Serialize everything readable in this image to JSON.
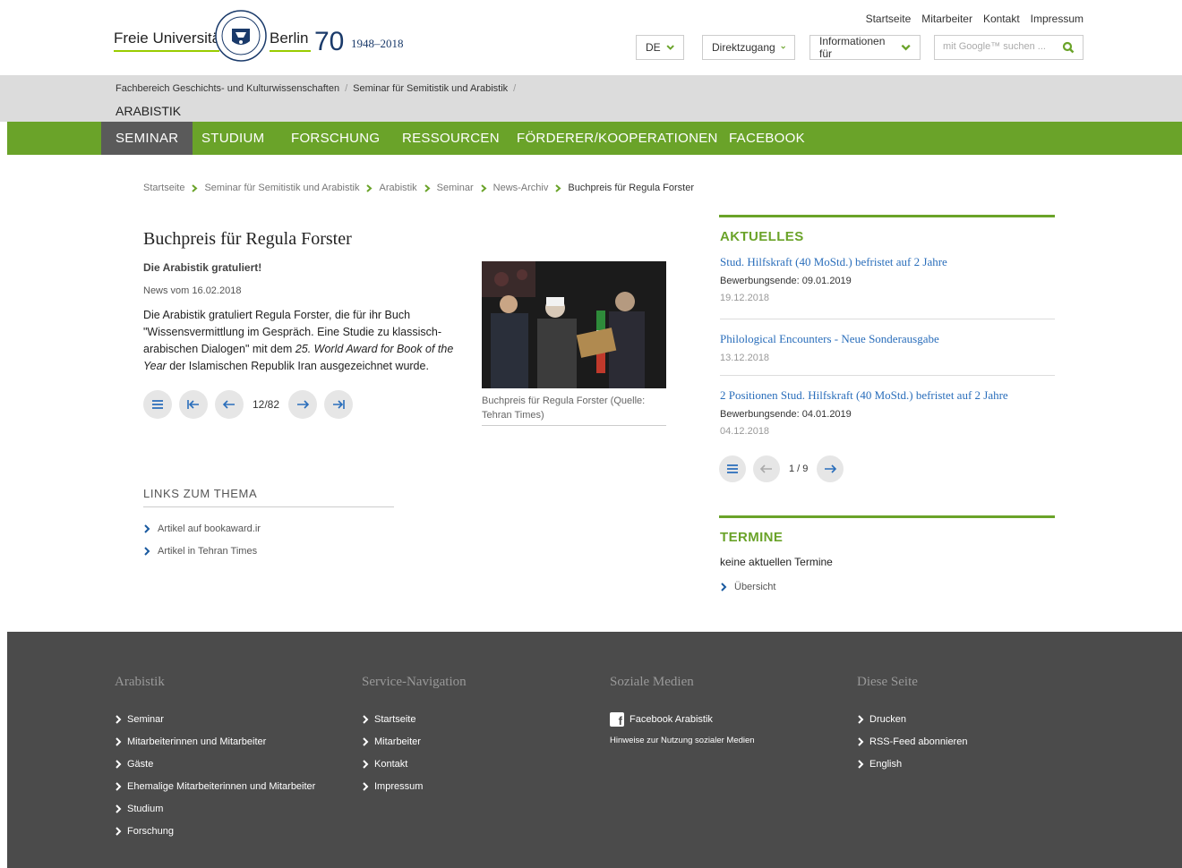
{
  "header": {
    "logo_left": "Freie Universität",
    "logo_right": "Berlin",
    "anniversary_number": "70",
    "anniversary_years": "1948–2018",
    "service_links": [
      "Startseite",
      "Mitarbeiter",
      "Kontakt",
      "Impressum"
    ],
    "language_label": "DE",
    "direct_access_label": "Direktzugang",
    "info_for_label": "Informationen für",
    "search_placeholder": "mit Google™ suchen ..."
  },
  "greybar": {
    "crumbs": [
      "Fachbereich Geschichts- und Kulturwissenschaften",
      "Seminar für Semitistik und Arabistik"
    ],
    "section": "ARABISTIK"
  },
  "nav": {
    "items": [
      "SEMINAR",
      "STUDIUM",
      "FORSCHUNG",
      "RESSOURCEN",
      "FÖRDERER/KOOPERATIONEN",
      "FACEBOOK"
    ]
  },
  "breadcrumb": {
    "items": [
      "Startseite",
      "Seminar für Semitistik und Arabistik",
      "Arabistik",
      "Seminar",
      "News-Archiv"
    ],
    "current": "Buchpreis für Regula Forster"
  },
  "article": {
    "title": "Buchpreis für Regula Forster",
    "subtitle": "Die Arabistik gratuliert!",
    "date": "News vom 16.02.2018",
    "body_1": "Die Arabistik gratuliert Regula Forster, die für ihr Buch \"Wissensvermittlung im Gespräch. Eine Studie zu klassisch-arabischen Dialogen\" mit dem ",
    "body_em1": "25. World Award for Book of the Year",
    "body_2": " der Islamischen Republik Iran ausgezeichnet wurde.",
    "pager_count": "12/82",
    "image_caption": "Buchpreis für Regula Forster (Quelle: Tehran Times)"
  },
  "links": {
    "heading": "LINKS ZUM THEMA",
    "items": [
      "Artikel auf bookaward.ir",
      "Artikel in Tehran Times"
    ]
  },
  "aktuelles": {
    "heading": "AKTUELLES",
    "items": [
      {
        "title": "Stud. Hilfskraft (40 MoStd.) befristet auf 2 Jahre",
        "deadline": "Bewerbungsende: 09.01.2019",
        "date": "19.12.2018"
      },
      {
        "title": "Philological Encounters - Neue Sonderausgabe",
        "deadline": "",
        "date": "13.12.2018"
      },
      {
        "title": "2 Positionen Stud. Hilfskraft (40 MoStd.) befristet auf 2 Jahre",
        "deadline": "Bewerbungsende: 04.01.2019",
        "date": "04.12.2018"
      }
    ],
    "pager_count": "1 / 9"
  },
  "termine": {
    "heading": "TERMINE",
    "text": "keine aktuellen Termine",
    "link": "Übersicht"
  },
  "footer": {
    "col1": {
      "heading": "Arabistik",
      "items": [
        "Seminar",
        "Mitarbeiterinnen und Mitarbeiter",
        "Gäste",
        "Ehemalige Mitarbeiterinnen und Mitarbeiter",
        "Studium",
        "Forschung"
      ]
    },
    "col2": {
      "heading": "Service-Navigation",
      "items": [
        "Startseite",
        "Mitarbeiter",
        "Kontakt",
        "Impressum"
      ]
    },
    "col3": {
      "heading": "Soziale Medien",
      "facebook": "Facebook Arabistik",
      "hint": "Hinweise zur Nutzung sozialer Medien"
    },
    "col4": {
      "heading": "Diese Seite",
      "items": [
        "Drucken",
        "RSS-Feed abonnieren",
        "English"
      ]
    }
  },
  "colors": {
    "green": "#6aa329",
    "blue": "#2a6ebb",
    "footer": "#4b4b4b",
    "active_nav": "#5a5a5a"
  }
}
